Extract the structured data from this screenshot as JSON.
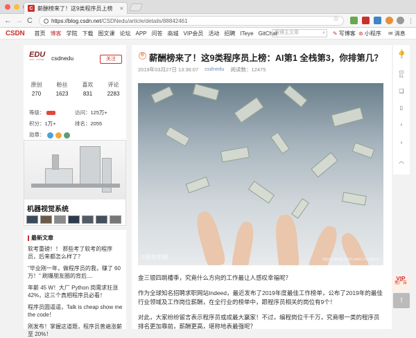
{
  "tab": {
    "favicon": "C",
    "title": "薪酬榜来了！这9类程序员上榜",
    "close": "×"
  },
  "url": {
    "host": "https://blog.csdn.net",
    "path": "/CSDNedu/article/details/88842461"
  },
  "nav_icons": {
    "back": "←",
    "forward": "→",
    "reload": "C",
    "star": "☆"
  },
  "csdn": {
    "logo": "CSDN",
    "links": [
      "首页",
      "博客",
      "学院",
      "下载",
      "图文课",
      "论坛",
      "APP",
      "问答",
      "商城",
      "VIP会员",
      "活动",
      "招聘",
      "ITeye",
      "GitChat"
    ],
    "search_placeholder": "搜博主文章",
    "write": "写博客",
    "mini": "小程序",
    "msg": "消息"
  },
  "profile": {
    "logo": "EDU",
    "logo_sub": "csdn · college",
    "name": "csdnedu",
    "follow": "关注",
    "stats": [
      {
        "label": "原创",
        "value": "270"
      },
      {
        "label": "粉丝",
        "value": "1623"
      },
      {
        "label": "喜欢",
        "value": "831"
      },
      {
        "label": "评论",
        "value": "2283"
      }
    ],
    "level_label": "等级：",
    "visits_label": "访问：",
    "visits": "125万+",
    "points_label": "积分：",
    "points": "1万+",
    "rank_label": "排名：",
    "rank": "2055",
    "medals_label": "勋章："
  },
  "ad": {
    "title": "机器视觉系统"
  },
  "recent": {
    "heading": "最新文章",
    "items": [
      "软考重磅！！ 那些考了软考的程序员，后来都怎么样了？",
      "\"毕业刚一年，做程序员的我，赚了 60 万！\" 刷爆朋友圈的背后....",
      "年薪 45 W！大厂 Python 岗需求狂涨 42%，这三个真相程序员必看！",
      "程序员圆逼逼，Talk is cheap show me the code！",
      "刚发布！掌握这道题，程序员普遍涨薪至 20%！"
    ]
  },
  "article": {
    "badge": "原",
    "title": "薪酬榜来了！这9类程序员上榜：AI第1 全栈第3，你排第几？",
    "date": "2019年03月27日 13:36:07",
    "author": "csdnedu",
    "reads": "阅读数：12475",
    "watermark": "©视觉中国",
    "watermark2": "https://blog.csdn.net/CSDNedu",
    "p1": "金三银四跳槽季，究竟什么方向的工作最让人感叹幸福呢？",
    "p2": "作为全球知名招聘求职网站Indeed，最近发布了2019年度最佳工作榜单，公布了2019年的最佳行业领域及工作岗位薪酬，在全行业的榜单中，跟程序员相关的岗位有9个！",
    "p3": "对此，大家纷纷留言表示程序员或成最大赢家！不过，编程岗位千千万，究竟哪一类的程序员排名更加靠前，薪酬更高，堪称地表最强呢？"
  },
  "side": {
    "like_count": "3",
    "comment_count": "51",
    "vip_top": "VIP",
    "vip_bottom": "免广告"
  }
}
